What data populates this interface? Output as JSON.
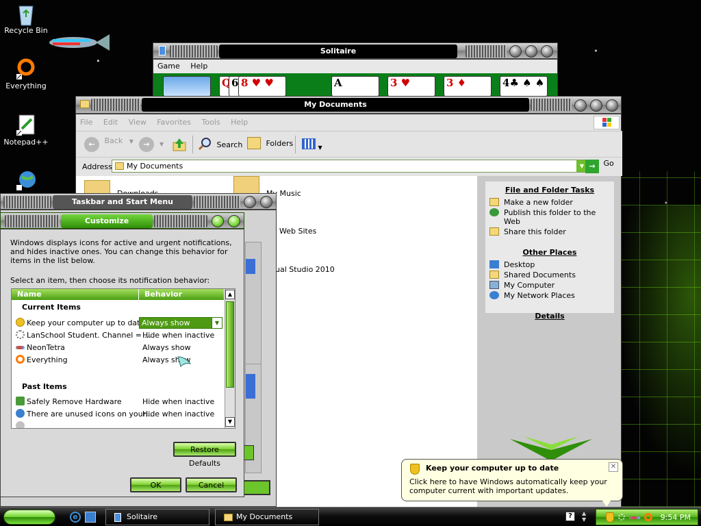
{
  "desktop": {
    "icons": [
      {
        "label": "Recycle Bin"
      },
      {
        "label": "Everything"
      },
      {
        "label": "Notepad++"
      }
    ]
  },
  "solitaire": {
    "title": "Solitaire",
    "menu": [
      "Game",
      "Help"
    ],
    "cards": [
      "Q",
      "6",
      "8",
      "A",
      "3",
      "3",
      "4"
    ]
  },
  "explorer": {
    "title": "My Documents",
    "menu": [
      "File",
      "Edit",
      "View",
      "Favorites",
      "Tools",
      "Help"
    ],
    "toolbar": {
      "back": "Back",
      "search": "Search",
      "folders": "Folders"
    },
    "address_label": "Address",
    "address_value": "My Documents",
    "go_label": "Go",
    "items": [
      "Downloads",
      "My Music",
      "Web Sites",
      "ual Studio 2010"
    ],
    "file_tasks": {
      "header": "File and Folder Tasks",
      "items": [
        "Make a new folder",
        "Publish this folder to the Web",
        "Share this folder"
      ]
    },
    "other_places": {
      "header": "Other Places",
      "items": [
        "Desktop",
        "Shared Documents",
        "My Computer",
        "My Network Places"
      ]
    },
    "details": {
      "header": "Details"
    }
  },
  "taskbar_props": {
    "title": "Taskbar and Start Menu Properties"
  },
  "customize": {
    "title": "Customize Notifications",
    "description": "Windows displays icons for active and urgent notifications, and hides inactive ones. You can change this behavior for items in the list below.",
    "instruction": "Select an item, then choose its notification behavior:",
    "columns": {
      "name": "Name",
      "behavior": "Behavior"
    },
    "current_header": "Current Items",
    "past_header": "Past Items",
    "current_items": [
      {
        "name": "Keep your computer up to date.",
        "behavior": "Always show"
      },
      {
        "name": "LanSchool Student.  Channel = ...",
        "behavior": "Hide when inactive"
      },
      {
        "name": "NeonTetra",
        "behavior": "Always show"
      },
      {
        "name": "Everything",
        "behavior": "Always show"
      }
    ],
    "past_items": [
      {
        "name": "Safely Remove Hardware",
        "behavior": "Hide when inactive"
      },
      {
        "name": "There are unused icons on your...",
        "behavior": "Hide when inactive"
      }
    ],
    "restore_label": "Restore Defaults",
    "ok_label": "OK",
    "cancel_label": "Cancel"
  },
  "balloon": {
    "title": "Keep your computer up to date",
    "text": "Click here to have Windows automatically keep your computer current with important updates."
  },
  "taskbar": {
    "items": [
      "Solitaire",
      "My Documents"
    ],
    "clock": "9:54 PM"
  }
}
